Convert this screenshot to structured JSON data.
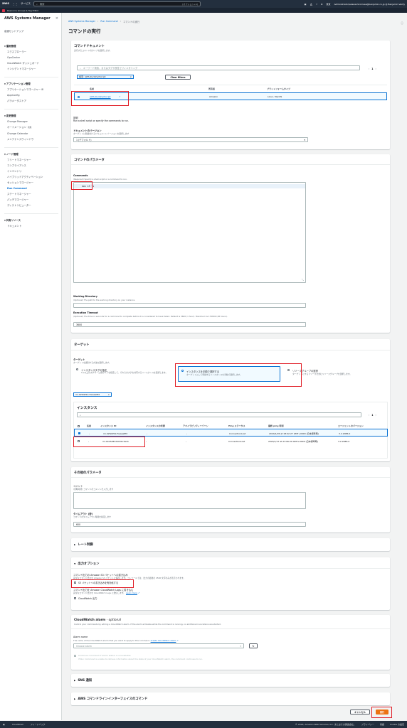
{
  "topbar": {
    "logo": "aws",
    "services": "サービス",
    "search_placeholder": "検索",
    "search_shortcut": "[オプション+S]",
    "region": "東京",
    "account": "Administrator/ezawa.hiromasa@benjamin.co.jp @ Benjamin Verify"
  },
  "resource_groups": "Resource Groups & Tag Editor",
  "sidebar": {
    "title": "AWS Systems Manager",
    "close": "×",
    "quick_setup": "高速セットアップ",
    "groups": [
      {
        "title": "運用管理",
        "items": [
          "エクスプローラー",
          "OpsCenter",
          "CloudWatch ダッシュボード",
          "インシデントマネージャー"
        ]
      },
      {
        "title": "アプリケーション管理",
        "items": [
          "アプリケーションマネージャー",
          "AppConfig",
          "パラメータストア"
        ]
      },
      {
        "title": "変更管理",
        "items": [
          "Change Manager",
          "オートメーション",
          "Change Calendar",
          "メンテナンスウィンドウ"
        ]
      },
      {
        "title": "ノード管理",
        "items": [
          "フリートマネージャー",
          "コンプライアンス",
          "インベントリ",
          "ハイブリッドアクティベーション",
          "セッションマネージャー",
          "Run Command",
          "ステートマネージャー",
          "パッチマネージャー",
          "ディストリビューター"
        ]
      },
      {
        "title": "共有リソース",
        "items": [
          "ドキュメント"
        ]
      }
    ],
    "active_item": "Run Command",
    "new_badge": "新規"
  },
  "breadcrumb": [
    "AWS Systems Manager",
    "Run Command",
    "コマンドの実行"
  ],
  "page_title": "コマンドの実行",
  "doc_panel": {
    "title": "コマンドドキュメント",
    "subtitle": "実行するコマンドのタイプを選択します。",
    "search_placeholder": "キーワード検索、またはタグや属性でフィルタリング",
    "page": "1",
    "filter_token": "検索: AWS-RunShellScript",
    "clear_filters": "Clear filters",
    "columns": [
      "名前",
      "所有者",
      "プラットフォームタイプ"
    ],
    "row": {
      "name": "AWS-RunShellScript",
      "owner": "Amazon",
      "platform": "Linux, MacOS"
    },
    "desc_label": "説明",
    "desc_value": "Run a shell script or specify the commands to run.",
    "version_label": "ドキュメントのバージョン",
    "version_desc": "ターゲットに関連付けるドキュメントバージョンを選択します",
    "version_value": "1 (デフォルト)"
  },
  "params_panel": {
    "title": "コマンドのパラメータ",
    "commands_label": "Commands",
    "commands_desc": "(Required) Specify a shell script or a command to run.",
    "commands_value": "aws s3 ls",
    "wd_label": "Working Directory",
    "wd_desc": "(Optional) The path to the working directory on your instance.",
    "timeout_label": "Execution Timeout",
    "timeout_desc": "(Optional) The time in seconds for a command to complete before it is considered to have failed. Default is 3600 (1 hour). Maximum is 172800 (48 hours).",
    "timeout_value": "3600"
  },
  "target_panel": {
    "title": "ターゲット",
    "label": "ターゲット",
    "desc": "ターゲットを識別する方法を選択します。",
    "options": [
      {
        "title": "インスタンスタグの指定",
        "desc": "1つ以上のタグキーと値のペアを指定して、それらのタグを共有するインスタンスを選択します。"
      },
      {
        "title": "インスタンスを手動で選択する",
        "desc": "ターゲットとして登録するインスタンスを手動で選択します。"
      },
      {
        "title": "リソースグループの選択",
        "desc": "ターゲットにするリソースを含むリソースグループを選択します。"
      }
    ],
    "selected_token": "mi-02fe9f21c5eaee8fd"
  },
  "instances": {
    "title": "インスタンス",
    "page": "1",
    "columns": [
      "名前",
      "インスタンス ID",
      "インスタンスの状態",
      "アベイラビリティーゾーン",
      "Ping ステータス",
      "最終 ping 時刻",
      "エージェントのバージョン"
    ],
    "rows": [
      {
        "name": "-",
        "id": "mi-02fe9f21c5eaee8fd",
        "state": "-",
        "az": "-",
        "ping": "ConnectionLost",
        "last_ping": "2024/1/26 at 18:02:27 GMT+0900 (日本標準時)",
        "agent": "3.2.2086.0",
        "checked": true
      },
      {
        "name": "-",
        "id": "mi-0415d83dd03bc3a41",
        "state": "-",
        "az": "-",
        "ping": "ConnectionLost",
        "last_ping": "2024/1/17 at 23:06:29 GMT+0900 (日本標準時)",
        "agent": "3.2.2086.0",
        "checked": false
      }
    ]
  },
  "other_panel": {
    "title": "その他のパラメータ",
    "comment_label": "コメント",
    "comment_desc": "(省略可能) コマンドのコメントを入力します",
    "timeout_label": "タイムアウト (秒)",
    "timeout_desc": "コマンドのタイムアウト時間を指定します",
    "timeout_value": "600"
  },
  "rate_panel": {
    "title": "レート制御"
  },
  "output_panel": {
    "title": "出力オプション",
    "s3_label": "コマンド出力の Amazon S3 バケットへの書き込み",
    "s3_desc": "完全なコマンド出力を Amazon S3 バケットに保存します。コンソールでは、出力の最後の 2500 文字のみが表示されます。",
    "s3_checkbox": "S3 バケットへの書き込みを有効化する",
    "cw_label": "コマンド出力を Amazon CloudWatch Logs に書き込む",
    "cw_desc": "完全なコマンド出力を CloudWatch Logs に送信します。",
    "cw_learn_more": "Learn more",
    "cw_checkbox": "CloudWatch 出力"
  },
  "alarm_panel": {
    "title": "CloudWatch alarm",
    "title_suffix": "- optional",
    "desc": "Control your commands by adding a CloudWatch alarm. If the alarm activates while the command is running, no additional invocations are started.",
    "name_label": "Alarm name",
    "name_desc": "The name of the CloudWatch alarm that you want to apply to this command.",
    "create_link": "Create CloudWatch alarm",
    "select_placeholder": "Choose alarm",
    "continue_label": "Continue command if alarm status is unavailable",
    "continue_desc": "If Run Command is unable to retrieve information about the state of your CloudWatch alarm, the command continues to run."
  },
  "sns_panel": {
    "title": "SNS 通知"
  },
  "cli_panel": {
    "title": "AWS コマンドラインインターフェイスのコマンド"
  },
  "actions": {
    "cancel": "キャンセル",
    "run": "実行"
  },
  "footer": {
    "cloudshell": "CloudShell",
    "feedback": "フィードバック",
    "copyright": "© 2024, Amazon Web Services, Inc. またはその関連会社。",
    "privacy": "プライバシー",
    "terms": "用語",
    "cookie": "Cookie の設定"
  },
  "colors": {
    "accent": "#0972d3",
    "primary_button": "#ec7211",
    "highlight": "#e01b24",
    "nav": "#232f3e"
  }
}
